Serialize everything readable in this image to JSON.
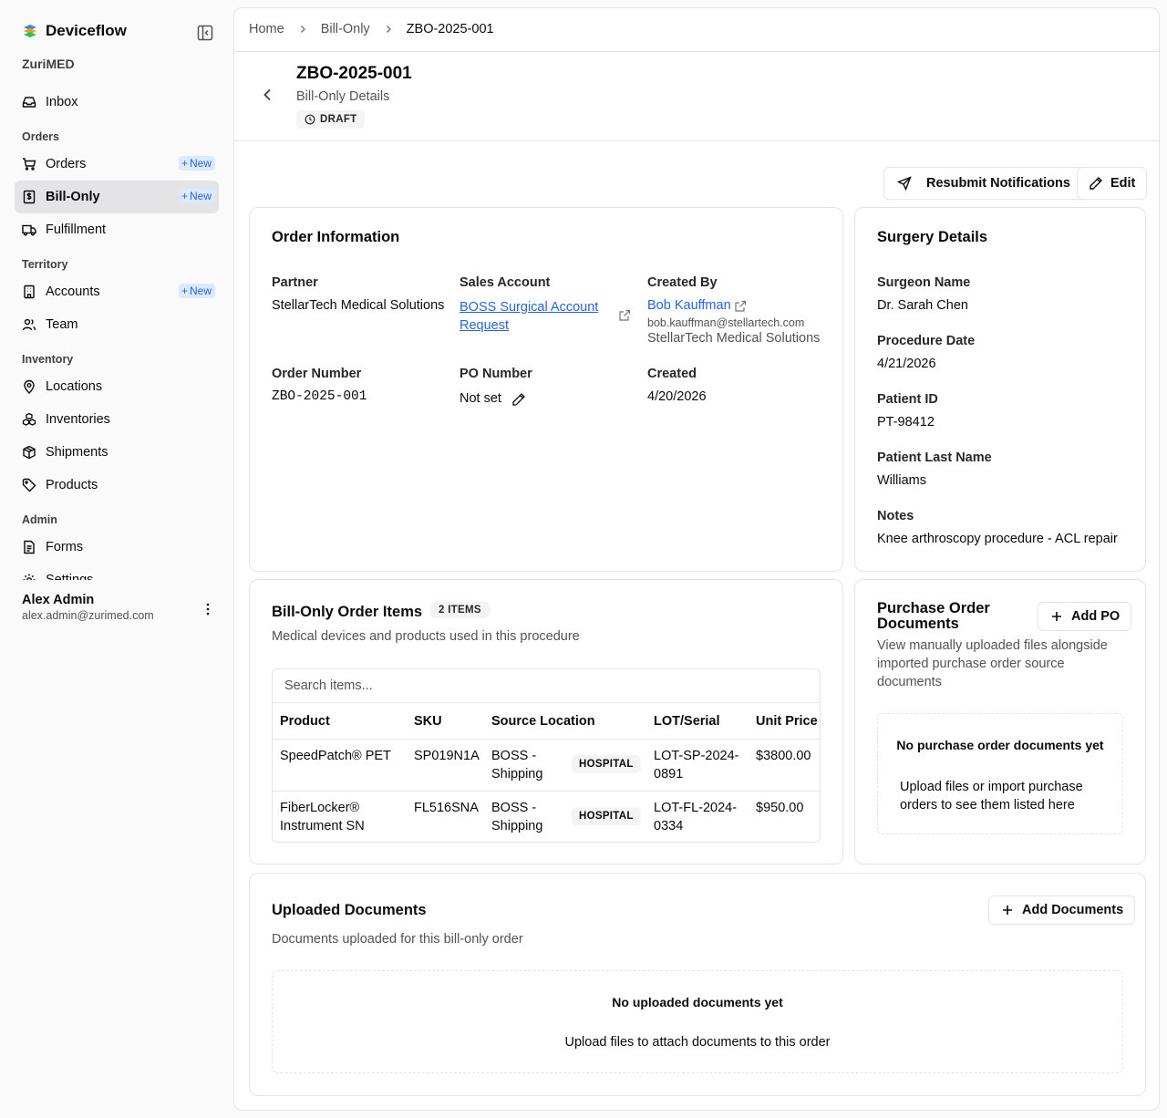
{
  "app": {
    "name": "Deviceflow",
    "org": "ZuriMED"
  },
  "sidebar": {
    "inbox": "Inbox",
    "groups": {
      "orders": "Orders",
      "territory": "Territory",
      "inventory": "Inventory",
      "admin": "Admin"
    },
    "items": {
      "orders": "Orders",
      "bill_only": "Bill-Only",
      "fulfillment": "Fulfillment",
      "accounts": "Accounts",
      "team": "Team",
      "locations": "Locations",
      "inventories": "Inventories",
      "shipments": "Shipments",
      "products": "Products",
      "forms": "Forms",
      "settings": "Settings"
    },
    "new_label": "New",
    "user": {
      "name": "Alex Admin",
      "email": "alex.admin@zurimed.com"
    }
  },
  "breadcrumb": {
    "home": "Home",
    "section": "Bill-Only",
    "current": "ZBO-2025-001"
  },
  "header": {
    "title": "ZBO-2025-001",
    "subtitle": "Bill-Only Details",
    "status": "DRAFT"
  },
  "actions": {
    "resubmit": "Resubmit Notifications",
    "edit": "Edit"
  },
  "order_info": {
    "title": "Order Information",
    "partner_label": "Partner",
    "partner": "StellarTech Medical Solutions",
    "sales_account_label": "Sales Account",
    "sales_account_line1": "BOSS Surgical Account",
    "sales_account_line2": "Request",
    "created_by_label": "Created By",
    "created_by_name": "Bob Kauffman",
    "created_by_email": "bob.kauffman@stellartech.com",
    "created_by_org": "StellarTech Medical Solutions",
    "order_number_label": "Order Number",
    "order_number": "ZBO-2025-001",
    "po_number_label": "PO Number",
    "po_number": "Not set",
    "created_label": "Created",
    "created": "4/20/2026"
  },
  "surgery": {
    "title": "Surgery Details",
    "surgeon_label": "Surgeon Name",
    "surgeon": "Dr. Sarah Chen",
    "procedure_date_label": "Procedure Date",
    "procedure_date": "4/21/2026",
    "patient_id_label": "Patient ID",
    "patient_id": "PT-98412",
    "patient_last_label": "Patient Last Name",
    "patient_last": "Williams",
    "notes_label": "Notes",
    "notes": "Knee arthroscopy procedure - ACL repair"
  },
  "items": {
    "title": "Bill-Only Order Items",
    "count": "2 ITEMS",
    "description": "Medical devices and products used in this procedure",
    "search_placeholder": "Search items...",
    "columns": {
      "product": "Product",
      "sku": "SKU",
      "source": "Source Location",
      "lot": "LOT/Serial",
      "price": "Unit Price"
    },
    "rows": [
      {
        "product_1": "SpeedPatch® PET",
        "product_2": "",
        "sku": "SP019N1A",
        "source_1": "BOSS -",
        "source_2": "Shipping",
        "type": "HOSPITAL",
        "lot_1": "LOT-SP-2024-",
        "lot_2": "0891",
        "price": "$3800.00"
      },
      {
        "product_1": "FiberLocker®",
        "product_2": "Instrument SN",
        "sku": "FL516SNA",
        "source_1": "BOSS -",
        "source_2": "Shipping",
        "type": "HOSPITAL",
        "lot_1": "LOT-FL-2024-",
        "lot_2": "0334",
        "price": "$950.00"
      }
    ]
  },
  "po_docs": {
    "title_1": "Purchase Order",
    "title_2": "Documents",
    "add": "Add PO",
    "desc_1": "View manually uploaded files alongside",
    "desc_2": "imported purchase order source",
    "desc_3": "documents",
    "empty_title": "No purchase order documents yet",
    "empty_1": "Upload files or import purchase",
    "empty_2": "orders to see them listed here"
  },
  "uploaded": {
    "title": "Uploaded Documents",
    "add": "Add Documents",
    "description": "Documents uploaded for this bill-only order",
    "empty_title": "No uploaded documents yet",
    "empty_desc": "Upload files to attach documents to this order"
  }
}
